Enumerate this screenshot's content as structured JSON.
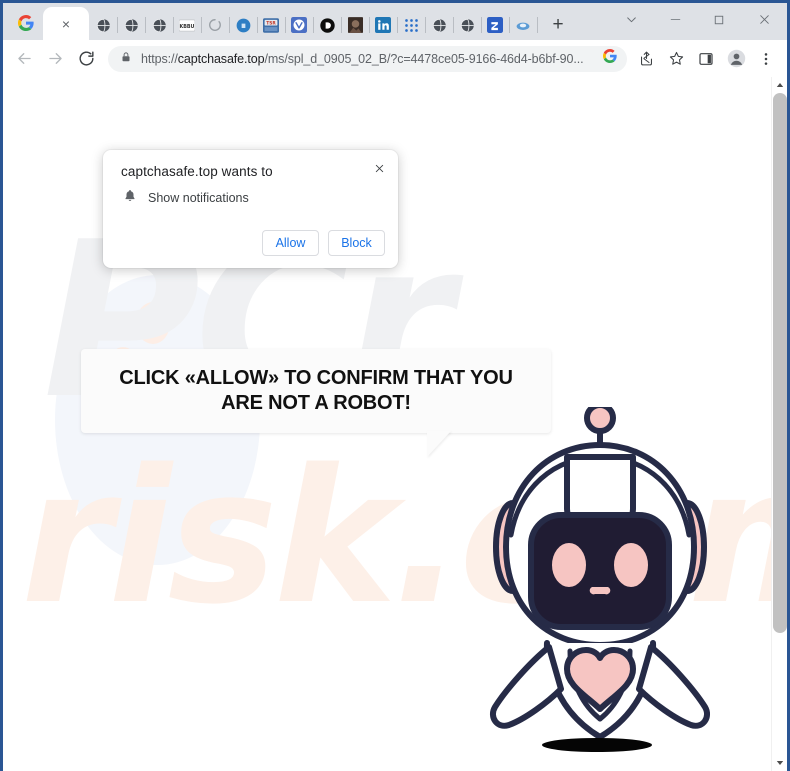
{
  "window": {
    "controls": [
      {
        "name": "tab-search-button",
        "glyph": "chevron-down"
      },
      {
        "name": "minimize-button",
        "glyph": "minimize"
      },
      {
        "name": "maximize-button",
        "glyph": "maximize"
      },
      {
        "name": "close-button",
        "glyph": "close"
      }
    ]
  },
  "tabstrip": {
    "google_tab_icon": "google-icon",
    "active_tab_close_glyph": "×",
    "new_tab_glyph": "+",
    "pinned_tabs": [
      {
        "name": "pinned-tab-globe-1",
        "icon": "globe-icon"
      },
      {
        "name": "pinned-tab-globe-2",
        "icon": "globe-icon"
      },
      {
        "name": "pinned-tab-globe-3",
        "icon": "globe-icon"
      },
      {
        "name": "pinned-tab-kbbu",
        "icon": "text-badge-icon"
      },
      {
        "name": "pinned-tab-spinner",
        "icon": "spinner-icon"
      },
      {
        "name": "pinned-tab-blue-circle",
        "icon": "blue-circle-icon"
      },
      {
        "name": "pinned-tab-tsr",
        "icon": "tsr-badge-icon"
      },
      {
        "name": "pinned-tab-vivaldi",
        "icon": "v-shield-icon"
      },
      {
        "name": "pinned-tab-dark-circle",
        "icon": "black-circle-icon"
      },
      {
        "name": "pinned-tab-photo",
        "icon": "photo-icon"
      },
      {
        "name": "pinned-tab-linkedin",
        "icon": "linkedin-icon"
      },
      {
        "name": "pinned-tab-grid",
        "icon": "blue-grid-icon"
      },
      {
        "name": "pinned-tab-globe-4",
        "icon": "globe-icon"
      },
      {
        "name": "pinned-tab-globe-5",
        "icon": "globe-icon"
      },
      {
        "name": "pinned-tab-square-blue",
        "icon": "blue-square-icon"
      },
      {
        "name": "pinned-tab-cloud",
        "icon": "cloud-icon"
      }
    ]
  },
  "toolbar": {
    "back_label": "Back",
    "forward_label": "Forward",
    "reload_label": "Reload",
    "url_prefix": "https://",
    "url_domain": "captchasafe.top",
    "url_path": "/ms/spl_d_0905_02_B/?c=4478ce05-9166-46d4-b6bf-90...",
    "url_full": "https://captchasafe.top/ms/spl_d_0905_02_B/?c=4478ce05-9166-46d4-b6bf-90...",
    "lock_icon": "lock-icon",
    "actions": [
      {
        "name": "google-lens-icon",
        "label": "Search with Google Lens"
      },
      {
        "name": "share-icon",
        "label": "Share this page"
      },
      {
        "name": "bookmark-star-icon",
        "label": "Bookmark this tab"
      },
      {
        "name": "side-panel-icon",
        "label": "Side panel"
      },
      {
        "name": "profile-avatar-icon",
        "label": "Profile"
      },
      {
        "name": "more-menu-icon",
        "label": "Customize and control Chrome"
      }
    ]
  },
  "permission_dialog": {
    "title": "captchasafe.top wants to",
    "permission_icon": "bell-icon",
    "permission_label": "Show notifications",
    "allow_label": "Allow",
    "block_label": "Block",
    "close_glyph": "✕"
  },
  "page": {
    "bubble_text": "CLICK «ALLOW» TO CONFIRM THAT YOU ARE NOT A ROBOT!",
    "watermark_top": "PCr",
    "watermark_bottom": "risk.com",
    "mascot": "robot-mascot"
  },
  "colors": {
    "window_frame": "#2a5694",
    "tabstrip_bg": "#dee1e6",
    "toolbar_bg": "#ffffff",
    "omnibox_bg": "#f1f3f4",
    "link_blue": "#1a73e8",
    "robot_outline": "#262B47",
    "robot_pink": "#F6C5C2",
    "robot_screen": "#201C33",
    "watermark_gray": "#f0f1f3",
    "watermark_peach": "#fdf0e8"
  },
  "scrollbar": {
    "up_glyph": "▲",
    "down_glyph": "▼"
  }
}
